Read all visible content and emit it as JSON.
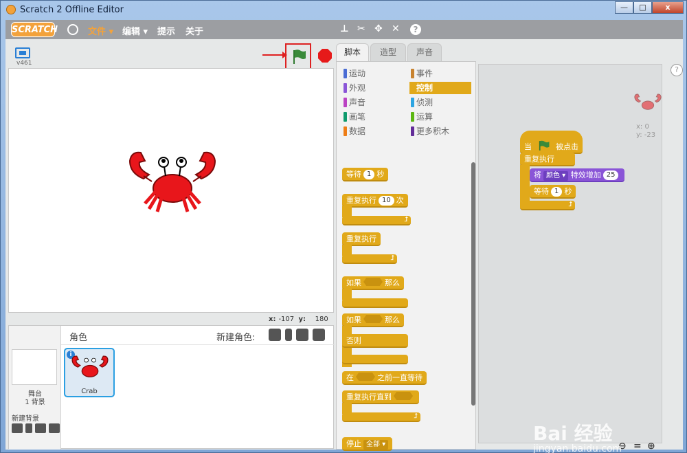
{
  "window": {
    "title": "Scratch 2 Offline Editor",
    "min": "—",
    "max": "□",
    "close": "x"
  },
  "menu": {
    "logo": "SCRATCH",
    "file": "文件 ▾",
    "edit": "编辑 ▾",
    "tips": "提示",
    "about": "关于"
  },
  "stage": {
    "version": "v461",
    "coord_x_label": "x:",
    "coord_x": "-107",
    "coord_y_label": "y:",
    "coord_y": "180"
  },
  "sprites": {
    "title": "角色",
    "new_sprite": "新建角色:",
    "stage_label": "舞台",
    "backdrop_count": "1 背景",
    "new_backdrop": "新建背景",
    "items": [
      {
        "name": "Crab"
      }
    ]
  },
  "tabs": [
    {
      "label": "脚本"
    },
    {
      "label": "造型"
    },
    {
      "label": "声音"
    }
  ],
  "categories": [
    {
      "label": "运动",
      "color": "#4a6cd4"
    },
    {
      "label": "事件",
      "color": "#c88330"
    },
    {
      "label": "外观",
      "color": "#8a55d7"
    },
    {
      "label": "控制",
      "color": "#e1a91a"
    },
    {
      "label": "声音",
      "color": "#bb42c3"
    },
    {
      "label": "侦测",
      "color": "#2ca5e2"
    },
    {
      "label": "画笔",
      "color": "#0e9a6c"
    },
    {
      "label": "运算",
      "color": "#5cb712"
    },
    {
      "label": "数据",
      "color": "#ee7d16"
    },
    {
      "label": "更多积木",
      "color": "#632d99"
    }
  ],
  "palette_blocks": {
    "wait_a": "等待",
    "wait_num": "1",
    "wait_b": "秒",
    "repeat_a": "重复执行",
    "repeat_num": "10",
    "repeat_b": "次",
    "forever": "重复执行",
    "if_a": "如果",
    "if_b": "那么",
    "ifelse_a": "如果",
    "ifelse_b": "那么",
    "else": "否则",
    "waituntil_a": "在",
    "waituntil_b": "之前一直等待",
    "repeatuntil": "重复执行直到",
    "stop": "停止",
    "stop_option": "全部 ▾"
  },
  "script": {
    "hat_a": "当",
    "hat_b": "被点击",
    "forever": "重复执行",
    "effect_a": "将",
    "effect_option": "颜色 ▾",
    "effect_b": "特效增加",
    "effect_num": "25",
    "wait_a": "等待",
    "wait_num": "1",
    "wait_b": "秒"
  },
  "sprite_info": {
    "x": "x: 0",
    "y": "y: -23"
  },
  "watermark": {
    "brand": "Bai 经验",
    "url": "jingyan.baidu.com"
  }
}
